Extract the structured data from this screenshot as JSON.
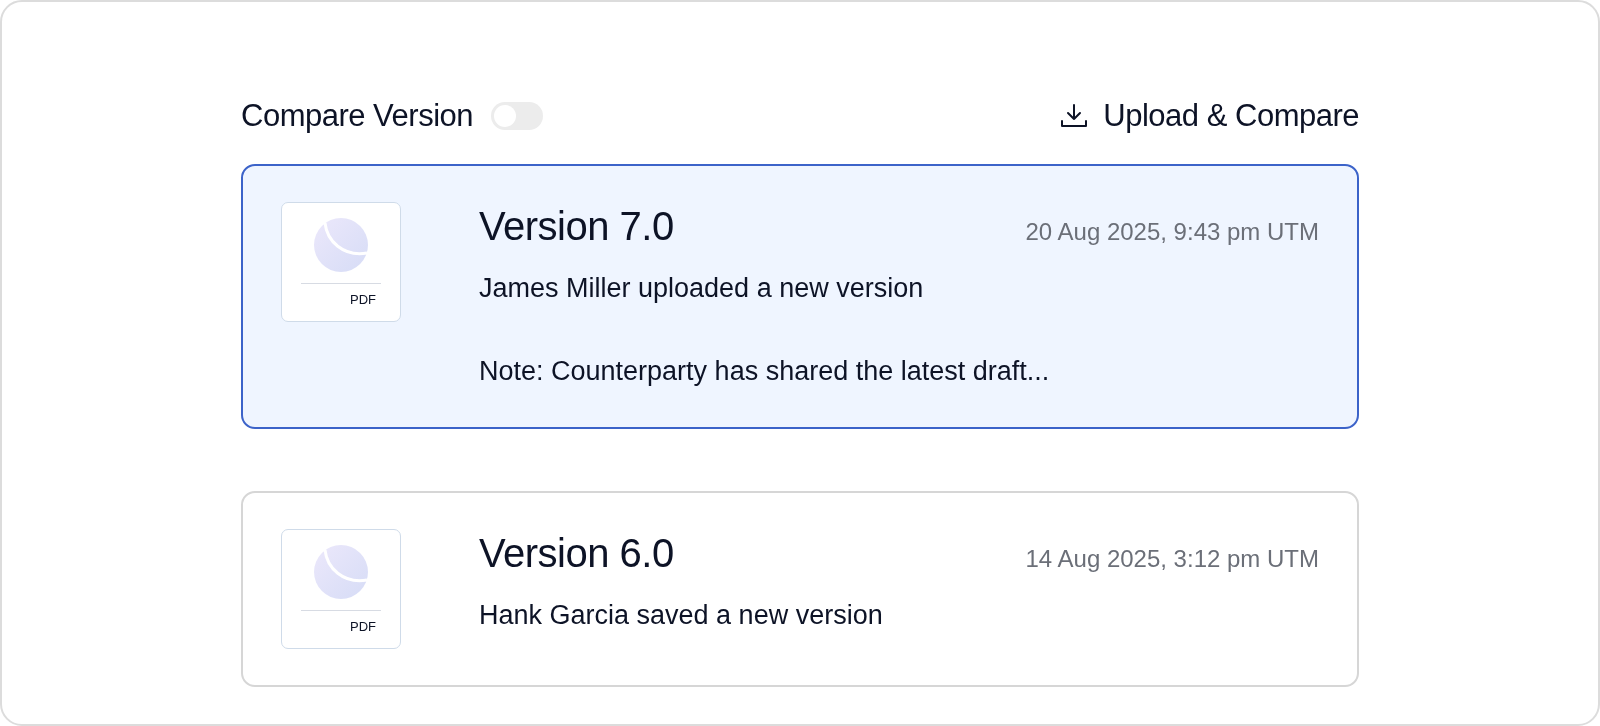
{
  "header": {
    "compare_label": "Compare Version",
    "compare_on": false,
    "upload_label": "Upload & Compare"
  },
  "versions": [
    {
      "title": "Version 7.0",
      "date": "20 Aug 2025, 9:43 pm UTM",
      "file_type": "PDF",
      "selected": true,
      "lines": [
        "James Miller uploaded a new version",
        "Note: Counterparty has shared the latest draft..."
      ]
    },
    {
      "title": "Version 6.0",
      "date": "14 Aug 2025, 3:12 pm UTM",
      "file_type": "PDF",
      "selected": false,
      "lines": [
        "Hank Garcia saved a new version"
      ]
    }
  ]
}
